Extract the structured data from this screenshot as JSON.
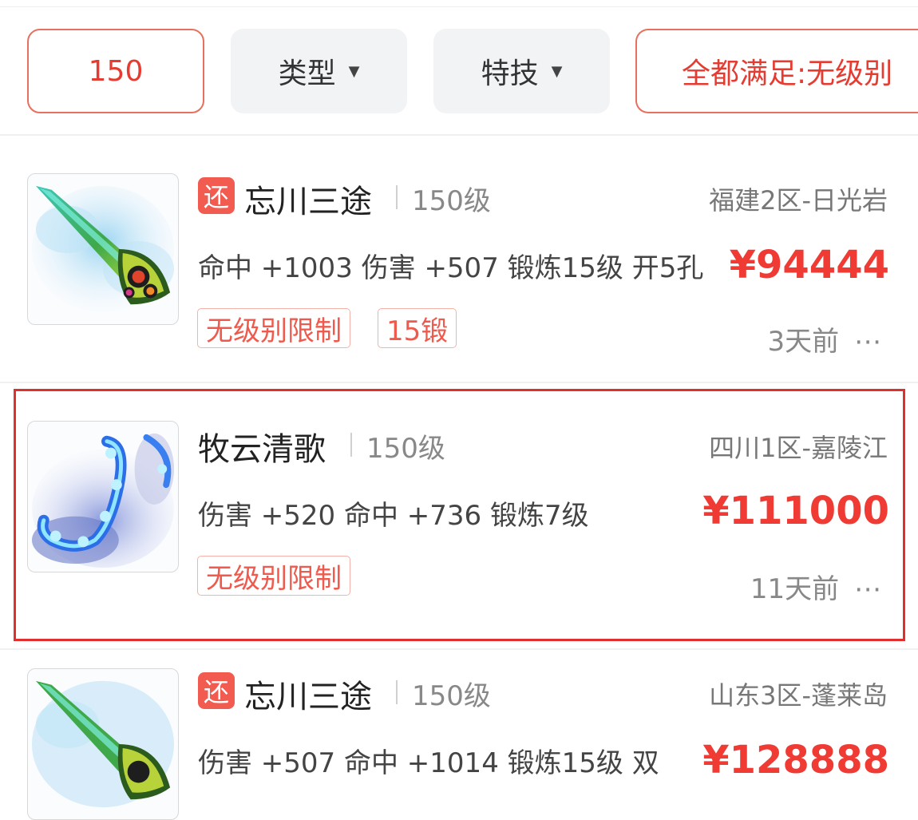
{
  "filters": {
    "level": "150",
    "type_label": "类型",
    "skill_label": "特技",
    "condition_label": "全都满足:无级别",
    "dropdown_glyph": "▼"
  },
  "listings": [
    {
      "badge": "还",
      "name": "忘川三途",
      "level": "150级",
      "server": "福建2区-日光岩",
      "attributes": "命中 +1003 伤害 +507 锻炼15级 开5孔",
      "price": "¥94444",
      "tags": [
        "无级别限制",
        "15锻"
      ],
      "time": "3天前",
      "more": "⋯",
      "image_icon": "green-blade-weapon-icon"
    },
    {
      "badge": "",
      "name": "牧云清歌",
      "level": "150级",
      "server": "四川1区-嘉陵江",
      "attributes": "伤害 +520 命中 +736 锻炼7级",
      "price": "¥111000",
      "tags": [
        "无级别限制"
      ],
      "time": "11天前",
      "more": "⋯",
      "image_icon": "blue-whip-weapon-icon",
      "highlighted": true
    },
    {
      "badge": "还",
      "name": "忘川三途",
      "level": "150级",
      "server": "山东3区-蓬莱岛",
      "attributes": "伤害 +507 命中 +1014 锻炼15级 双",
      "price": "¥128888",
      "image_icon": "green-blade-weapon-icon"
    }
  ],
  "colors": {
    "accent_red": "#ef3b34",
    "badge_red": "#f25b50",
    "highlight_border": "#e12f2f"
  }
}
